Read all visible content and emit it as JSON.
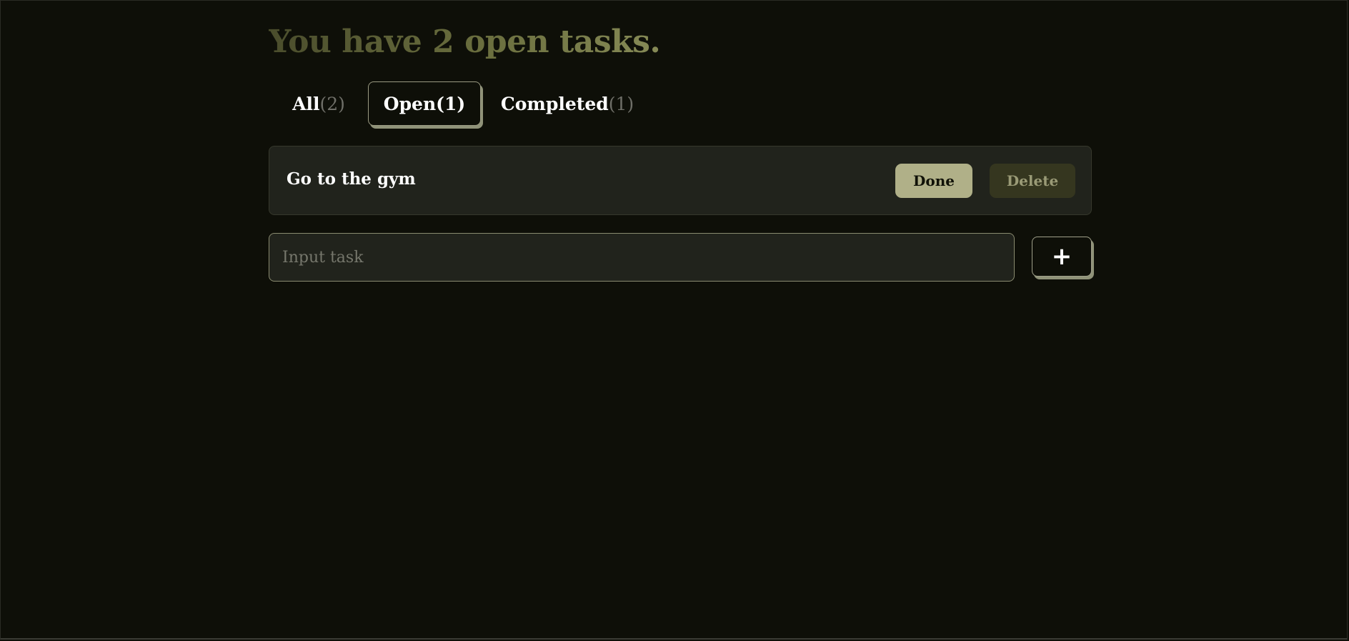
{
  "heading": {
    "prefix": "You have ",
    "count": "2",
    "suffix": "  open tasks."
  },
  "tabs": [
    {
      "label": "All",
      "count": "(2)"
    },
    {
      "label": "Open",
      "count": "(1)"
    },
    {
      "label": "Completed",
      "count": "(1)"
    }
  ],
  "tasks": [
    {
      "title": "Go to the gym",
      "done_label": "Done",
      "delete_label": "Delete"
    }
  ],
  "input": {
    "placeholder": "Input task",
    "value": ""
  },
  "add_button": {
    "label": "+"
  },
  "colors": {
    "background": "#0e0f08",
    "card": "#21231c",
    "accent": "#b0b088",
    "muted_button": "#35361f"
  }
}
